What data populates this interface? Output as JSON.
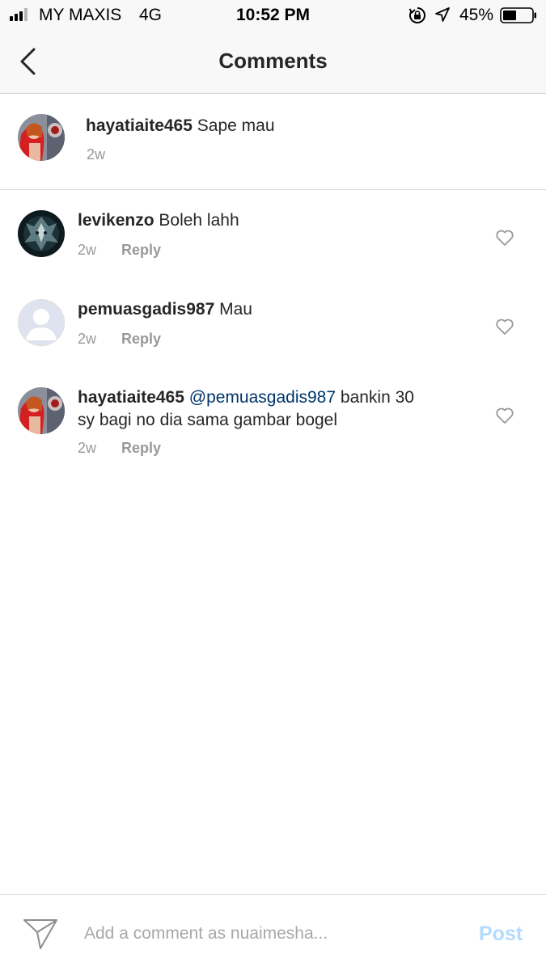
{
  "status_bar": {
    "carrier": "MY MAXIS",
    "network": "4G",
    "time": "10:52 PM",
    "battery_percent": "45%",
    "icons": [
      "signal-icon",
      "orientation-lock-icon",
      "location-arrow-icon",
      "battery-icon"
    ]
  },
  "nav": {
    "title": "Comments",
    "back_icon": "chevron-left-icon"
  },
  "caption": {
    "username": "hayatiaite465",
    "text": "Sape mau",
    "time": "2w"
  },
  "comments": [
    {
      "username": "levikenzo",
      "mention": "",
      "text": "Boleh lahh",
      "text_line2": "",
      "time": "2w",
      "reply_label": "Reply",
      "avatar": "dark-avatar"
    },
    {
      "username": "pemuasgadis987",
      "mention": "",
      "text": "Mau",
      "text_line2": "",
      "time": "2w",
      "reply_label": "Reply",
      "avatar": "default-avatar"
    },
    {
      "username": "hayatiaite465",
      "mention": "@pemuasgadis987",
      "text": "bankin 30",
      "text_line2": "sy bagi no dia sama gambar bogel",
      "time": "2w",
      "reply_label": "Reply",
      "avatar": "photo-avatar"
    }
  ],
  "composer": {
    "placeholder": "Add a comment as nuaimesha...",
    "post_label": "Post"
  },
  "colors": {
    "text": "#262626",
    "muted": "#999999",
    "mention": "#003569",
    "post_disabled": "#b3dbff"
  }
}
